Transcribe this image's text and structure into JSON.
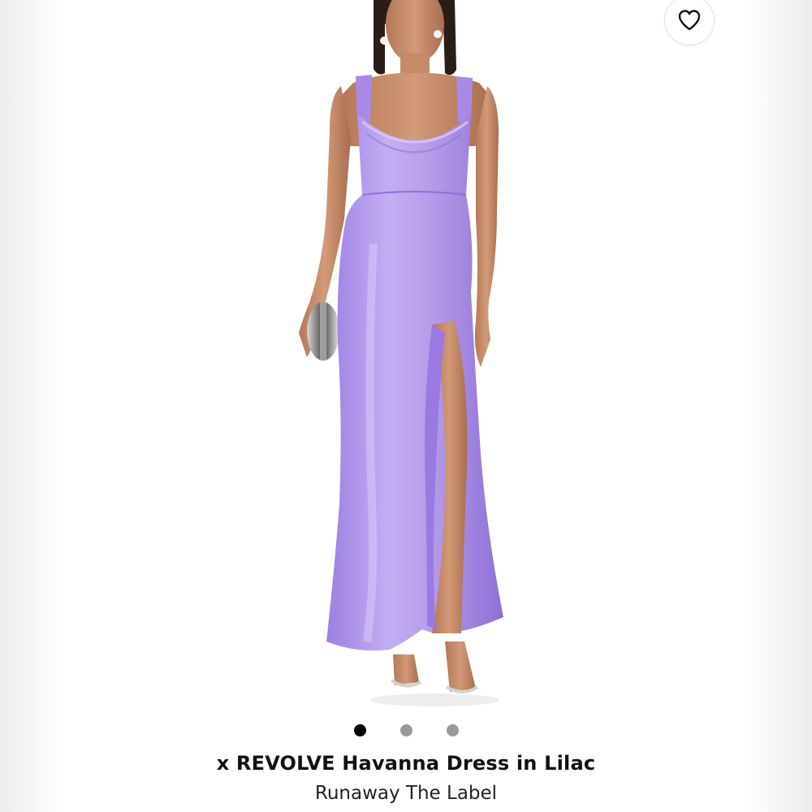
{
  "product": {
    "title": "x REVOLVE Havanna Dress in Lilac",
    "brand": "Runaway The Label",
    "image_description_icon": "product-photo-lilac-satin-dress"
  },
  "wishlist": {
    "icon": "heart-icon"
  },
  "carousel": {
    "total": 3,
    "active_index": 0
  },
  "colors": {
    "dress": "#b9a0ec",
    "dress_shadow": "#9d7ee0",
    "skin": "#c98d6b",
    "hair": "#2a1d18",
    "active_dot": "#000000",
    "inactive_dot": "#999999"
  }
}
